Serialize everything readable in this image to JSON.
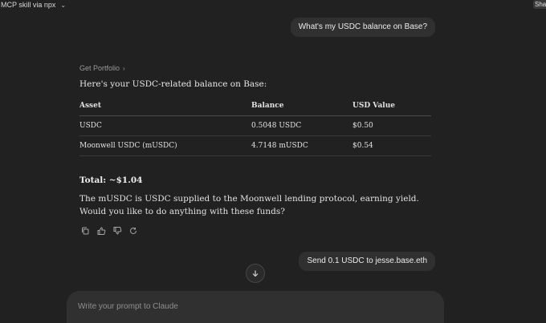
{
  "header": {
    "title": "MCP skill via npx",
    "share_label": "Share"
  },
  "messages": {
    "user_1": "What's my USDC balance on Base?",
    "assistant": {
      "tool_call_label": "Get Portfolio",
      "intro": "Here's your USDC-related balance on Base:",
      "table": {
        "headers": [
          "Asset",
          "Balance",
          "USD Value"
        ],
        "rows": [
          [
            "USDC",
            "0.5048 USDC",
            "$0.50"
          ],
          [
            "Moonwell USDC (mUSDC)",
            "4.7148 mUSDC",
            "$0.54"
          ]
        ]
      },
      "total": "Total: ~$1.04",
      "body": "The mUSDC is USDC supplied to the Moonwell lending protocol, earning yield. Would you like to do anything with these funds?"
    },
    "user_2": "Send  0.1 USDC to jesse.base.eth"
  },
  "composer": {
    "placeholder": "Write your prompt to Claude"
  }
}
